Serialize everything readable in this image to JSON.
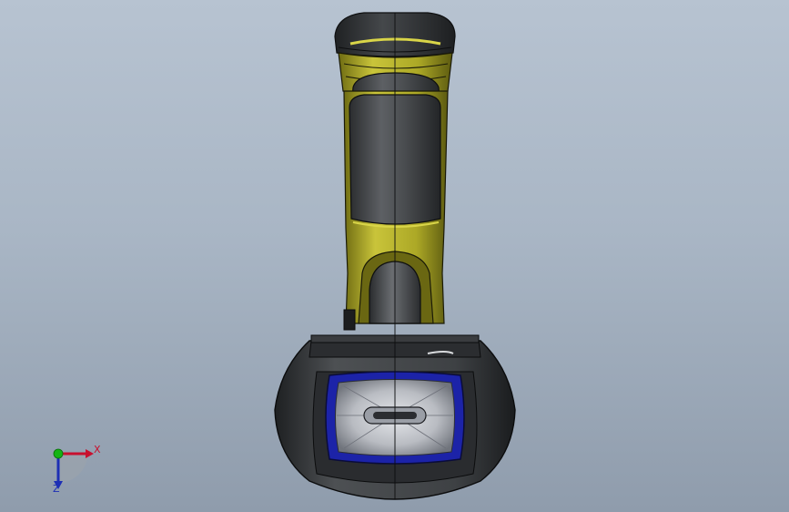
{
  "viewport": {
    "background_top": "#b7c3d1",
    "background_bottom": "#8f9cac"
  },
  "model": {
    "body_color": "#4a4d50",
    "accent_color": "#b6b22a",
    "lens_frame_color": "#1c23a8"
  },
  "triad": {
    "x_label": "X",
    "z_label": "Z",
    "x_color": "#c8102e",
    "y_color": "#14b414",
    "z_color": "#1d2fb5"
  }
}
